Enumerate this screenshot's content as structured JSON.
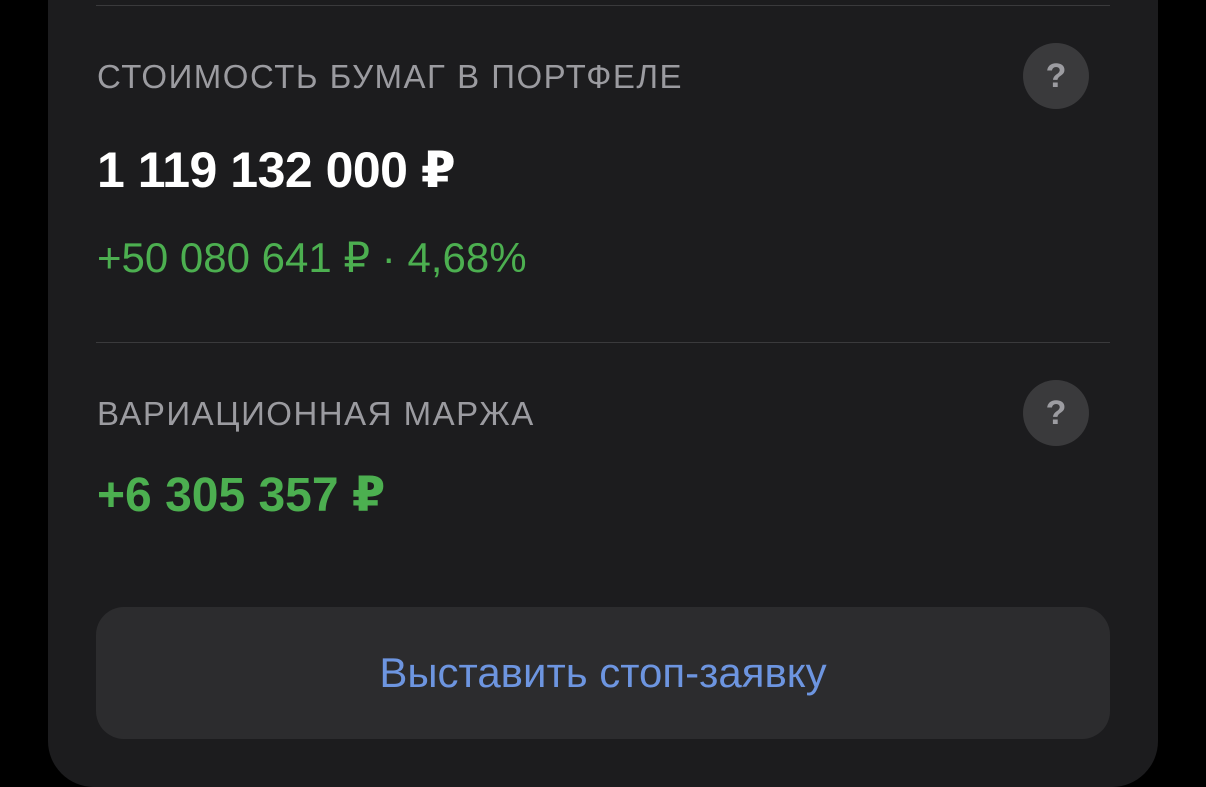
{
  "portfolio": {
    "title": "СТОИМОСТЬ БУМАГ В ПОРТФЕЛЕ",
    "help_label": "?",
    "value": "1 119 132 000 ₽",
    "change": "+50 080 641 ₽ · 4,68%"
  },
  "variation_margin": {
    "title": "ВАРИАЦИОННАЯ МАРЖА",
    "help_label": "?",
    "value": "+6 305 357 ₽"
  },
  "actions": {
    "stop_order_label": "Выставить стоп-заявку"
  },
  "colors": {
    "background": "#000000",
    "card": "#1c1c1e",
    "positive": "#4caf50",
    "link": "#6d95e0",
    "secondary_text": "#9b9ba0"
  }
}
